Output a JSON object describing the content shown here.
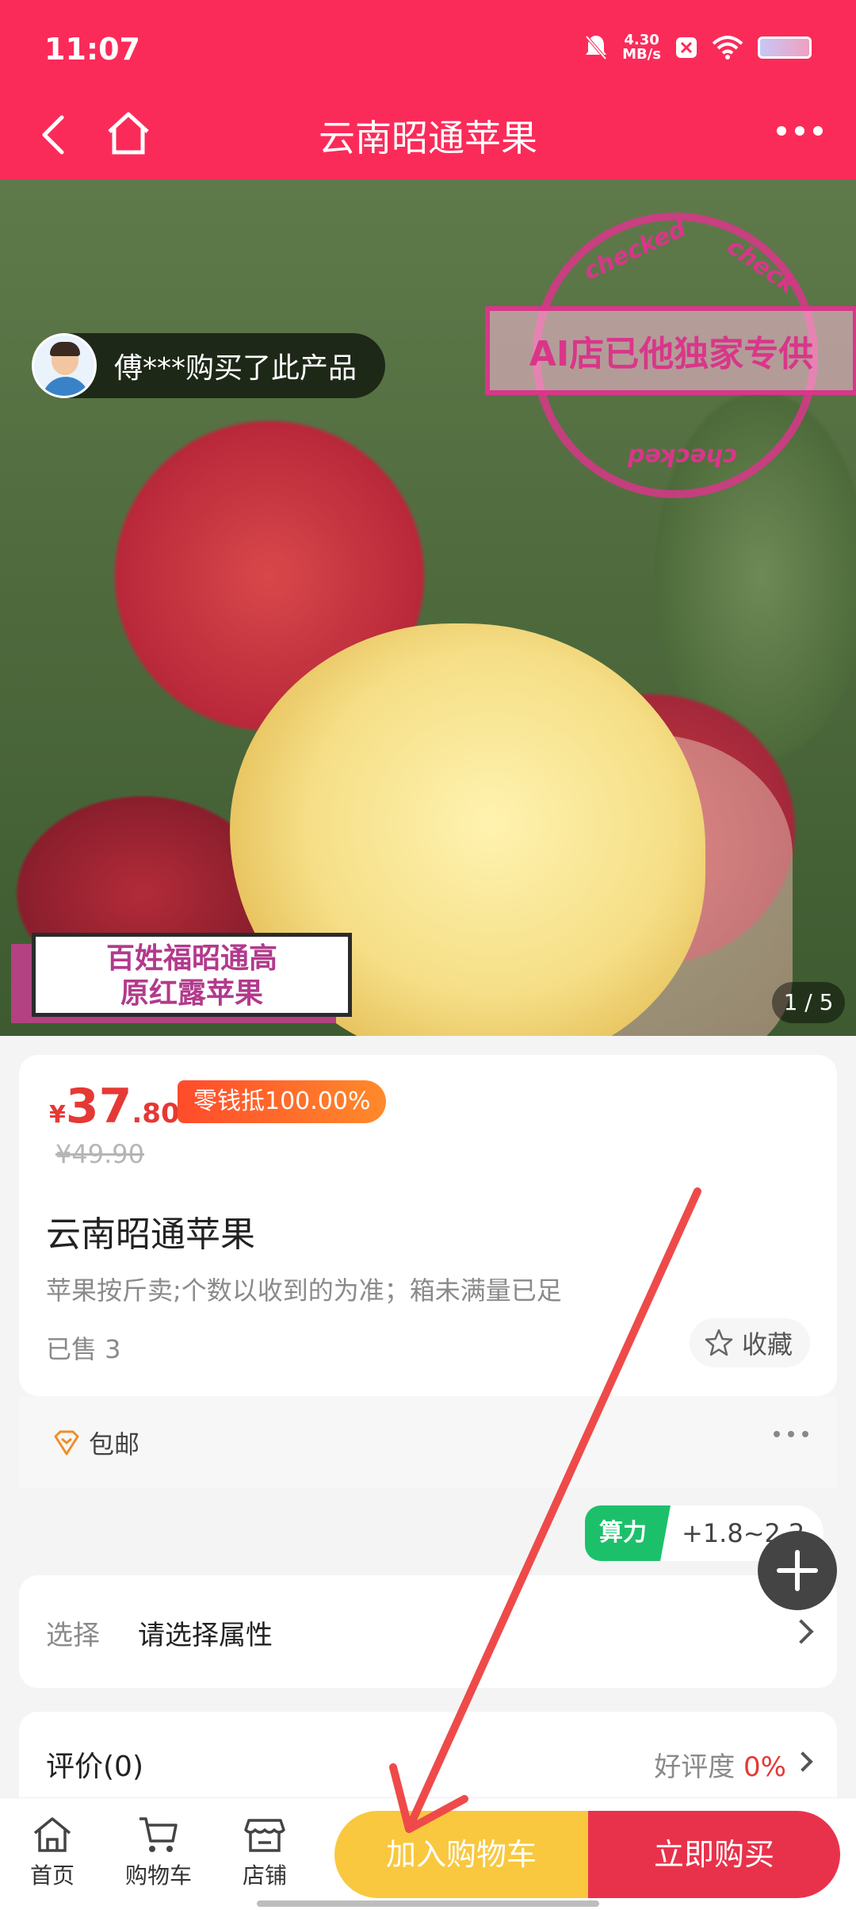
{
  "status_bar": {
    "time": "11:07",
    "net_speed_value": "4.30",
    "net_speed_unit": "MB/s",
    "icons": [
      "mute-icon",
      "x-icon",
      "wifi-icon",
      "battery-icon"
    ]
  },
  "header": {
    "title": "云南昭通苹果",
    "back_icon": "back-arrow-icon",
    "home_icon": "home-icon",
    "more_icon": "more-icon"
  },
  "gallery": {
    "buyer_notice": "傅***购买了此产品",
    "stamp_text": "AI店已他独家专供",
    "stamp_words": [
      "checked",
      "check",
      "checked"
    ],
    "promo_lines": [
      "百姓福昭通高",
      "原红露苹果"
    ],
    "counter": "1 / 5"
  },
  "product": {
    "currency": "¥",
    "price_int": "37",
    "price_dec": ".80",
    "change_tag": "零钱抵100.00%",
    "original_price": "¥49.90",
    "name": "云南昭通苹果",
    "description": "苹果按斤卖;个数以收到的为准；箱未满量已足",
    "sold": "已售 3",
    "favorite_label": "收藏"
  },
  "shipping": {
    "label": "包邮"
  },
  "compute": {
    "label": "算力",
    "value": "+1.8~2.2"
  },
  "select": {
    "key": "选择",
    "value": "请选择属性"
  },
  "review": {
    "title": "评价(0)",
    "rate_label": "好评度",
    "rate_value": "0%"
  },
  "bottom_bar": {
    "tabs": [
      {
        "label": "首页",
        "icon": "home-icon"
      },
      {
        "label": "购物车",
        "icon": "cart-icon"
      },
      {
        "label": "店铺",
        "icon": "store-icon"
      }
    ],
    "add_to_cart": "加入购物车",
    "buy_now": "立即购买"
  },
  "colors": {
    "brand": "#fb2b59",
    "price": "#e53935",
    "cart_button": "#f9c83f",
    "buy_button": "#e8324b",
    "compute_green": "#1dc06a"
  }
}
